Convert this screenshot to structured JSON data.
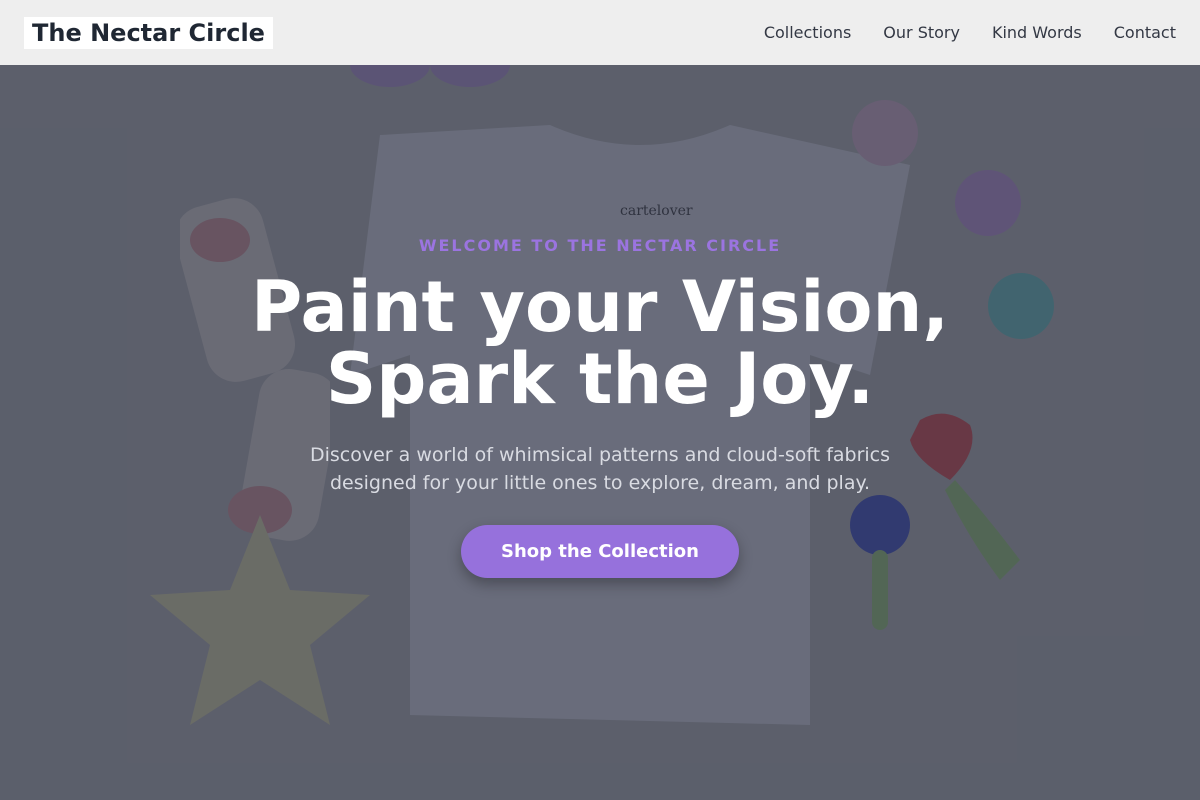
{
  "header": {
    "brand": "The Nectar Circle",
    "nav": [
      "Collections",
      "Our Story",
      "Kind Words",
      "Contact"
    ]
  },
  "hero": {
    "eyebrow": "WELCOME TO THE NECTAR CIRCLE",
    "headline_line1": "Paint your Vision,",
    "headline_line2": "Spark the Joy.",
    "subtitle_line1": "Discover a world of whimsical patterns and cloud-soft fabrics",
    "subtitle_line2": "designed for your little ones to explore, dream, and play.",
    "cta_label": "Shop the Collection",
    "shirt_tag": "cartelover"
  },
  "colors": {
    "accent": "#9b74e0",
    "button": "#9671dc",
    "header_bg": "#eeeeee",
    "overlay": "#2d3244"
  }
}
